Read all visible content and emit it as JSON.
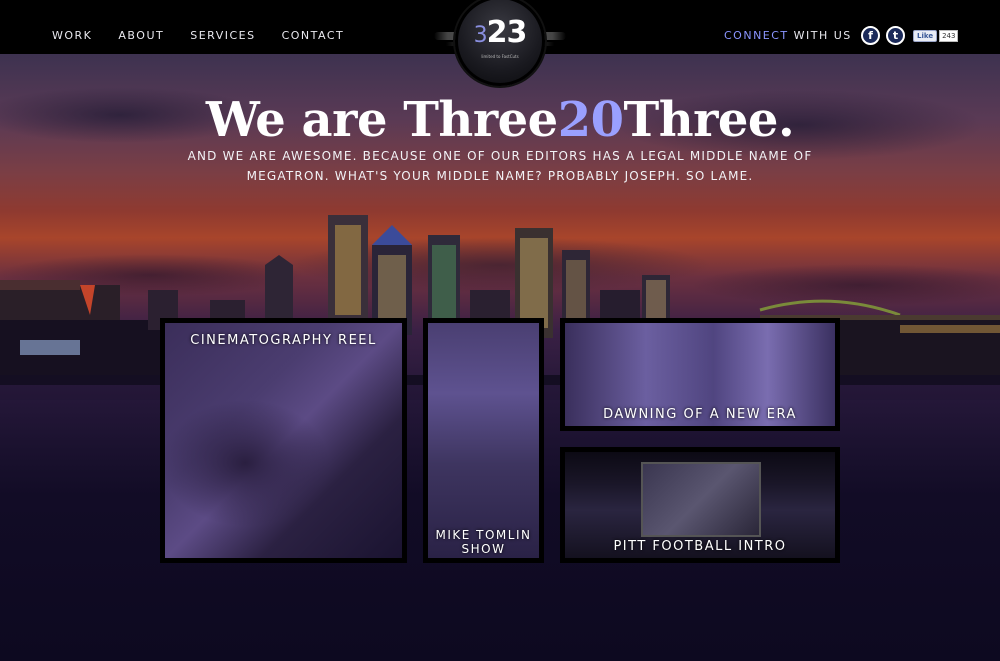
{
  "nav": {
    "items": [
      "WORK",
      "ABOUT",
      "SERVICES",
      "CONTACT"
    ]
  },
  "logo": {
    "small_digit": "3",
    "digits": "23",
    "tagline": "limited to FastCuts"
  },
  "connect": {
    "accent": "CONNECT",
    "rest": " WITH US"
  },
  "social": {
    "facebook_icon": "f",
    "twitter_icon": "t",
    "like_label": "Like",
    "like_count": "243"
  },
  "hero": {
    "title_pre": "We are Three",
    "title_num": "20",
    "title_post": "Three.",
    "subtitle": "AND WE ARE AWESOME. BECAUSE ONE OF OUR EDITORS HAS A LEGAL MIDDLE NAME OF MEGATRON. WHAT'S YOUR MIDDLE NAME? PROBABLY JOSEPH. SO LAME."
  },
  "tiles": [
    {
      "label": "CINEMATOGRAPHY REEL"
    },
    {
      "label_line1": "MIKE TOMLIN",
      "label_line2": "SHOW"
    },
    {
      "label": "DAWNING OF A NEW ERA"
    },
    {
      "label": "PITT FOOTBALL INTRO"
    }
  ],
  "colors": {
    "accent": "#8a95ff",
    "header_bg": "#000000",
    "sky_orange": "#a8452b"
  }
}
